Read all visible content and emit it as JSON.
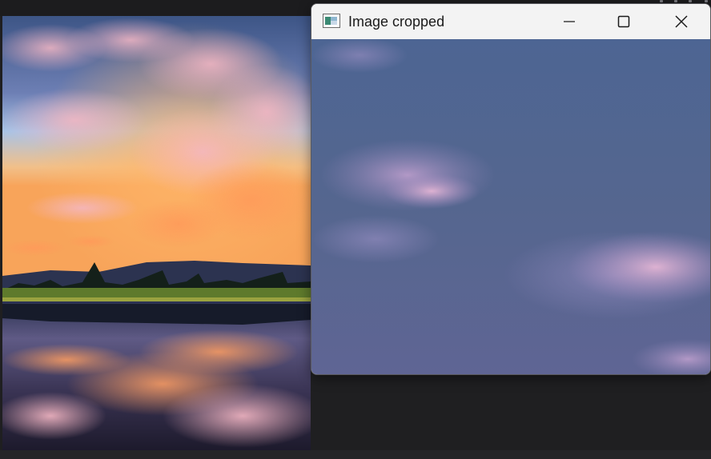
{
  "window": {
    "title": "Image cropped",
    "icon": "image-app-icon",
    "controls": [
      "minimize-icon",
      "maximize-icon",
      "close-icon"
    ]
  },
  "colors": {
    "desktop_background": "#1f1f21",
    "titlebar": "#f3f3f3",
    "crop_sky": "#56678f"
  }
}
